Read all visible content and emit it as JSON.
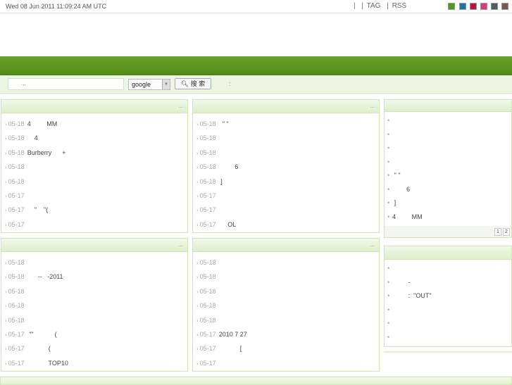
{
  "topbar": {
    "date": "Wed 08 Jun 2011 11:09:24 AM UTC",
    "links": [
      "|",
      "| TAG",
      "| RSS"
    ],
    "swatches": [
      "#4e9a1a",
      "#1f72a8",
      "#b5163c",
      "#d93a78",
      "#565b60",
      "#7a5a48"
    ]
  },
  "search": {
    "placeholder": "...",
    "engine": "google",
    "button": "搜 索",
    "colon": ":"
  },
  "panels": [
    {
      "more": "...",
      "items": [
        {
          "date": "05-18",
          "title": "4         MM"
        },
        {
          "date": "05-18",
          "title": "    4"
        },
        {
          "date": "05-18",
          "title": "Burberry      +"
        },
        {
          "date": "05-18",
          "title": ""
        },
        {
          "date": "05-18",
          "title": ""
        },
        {
          "date": "05-17",
          "title": ""
        },
        {
          "date": "05-17",
          "title": "    \"    \"("
        },
        {
          "date": "05-17",
          "title": ""
        }
      ]
    },
    {
      "more": "...",
      "items": [
        {
          "date": "05-18",
          "title": "  \" \""
        },
        {
          "date": "05-18",
          "title": ""
        },
        {
          "date": "05-18",
          "title": ""
        },
        {
          "date": "05-18",
          "title": "         6"
        },
        {
          "date": "05-18",
          "title": " ]"
        },
        {
          "date": "05-17",
          "title": ""
        },
        {
          "date": "05-17",
          "title": ""
        },
        {
          "date": "05-17",
          "title": "     OL"
        }
      ]
    },
    {
      "more": "...",
      "items": [
        {
          "date": "05-18",
          "title": ""
        },
        {
          "date": "05-18",
          "title": "      --   -2011"
        },
        {
          "date": "05-18",
          "title": ""
        },
        {
          "date": "05-18",
          "title": ""
        },
        {
          "date": "05-18",
          "title": ""
        },
        {
          "date": "05-17",
          "title": " \"\"            ("
        },
        {
          "date": "05-17",
          "title": "            ("
        },
        {
          "date": "05-17",
          "title": "            TOP10"
        }
      ]
    },
    {
      "more": "...",
      "items": [
        {
          "date": "05-18",
          "title": ""
        },
        {
          "date": "05-18",
          "title": ""
        },
        {
          "date": "05-18",
          "title": ""
        },
        {
          "date": "05-18",
          "title": ""
        },
        {
          "date": "05-18",
          "title": ""
        },
        {
          "date": "05-17",
          "title": "2010 7 27"
        },
        {
          "date": "05-17",
          "title": "            ["
        },
        {
          "date": "05-17",
          "title": ""
        }
      ]
    }
  ],
  "side1": {
    "bullet": "•",
    "items": [
      "",
      "",
      "",
      "",
      " \" \"",
      "        6",
      " ]",
      "4         MM"
    ],
    "pages": [
      "1",
      "2"
    ]
  },
  "side2": {
    "bullet": "•",
    "items": [
      "",
      "         -",
      "         :  \"OUT\"",
      "",
      "",
      ""
    ]
  }
}
